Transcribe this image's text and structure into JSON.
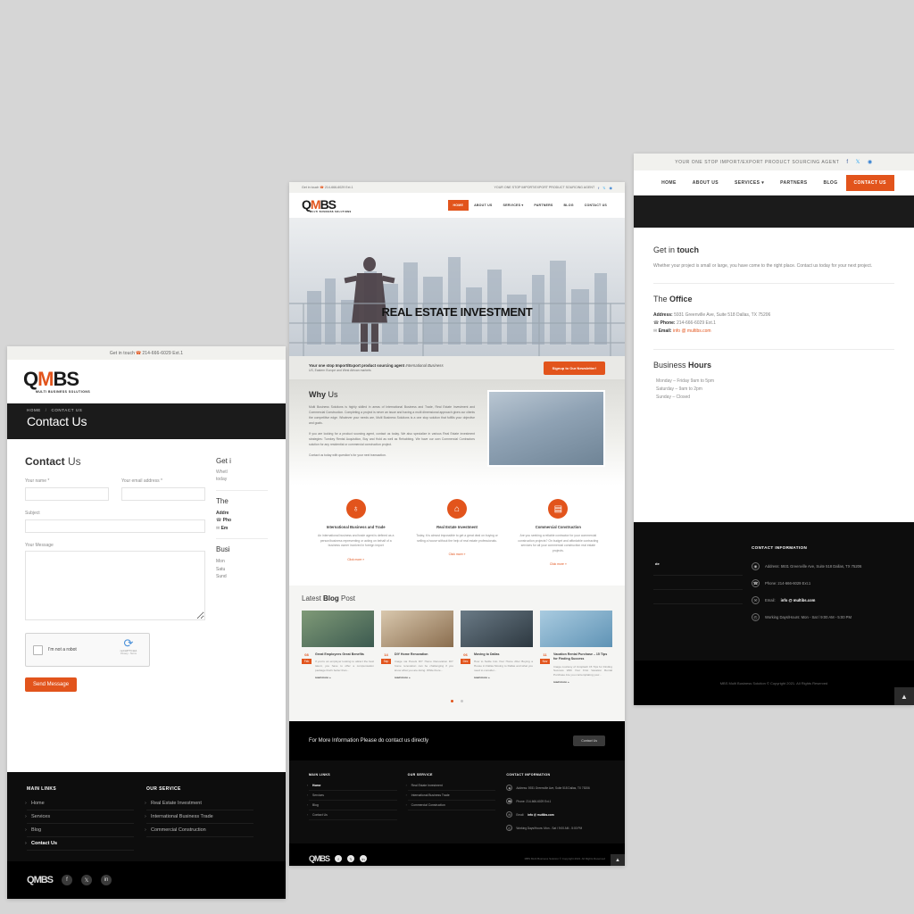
{
  "colors": {
    "accent": "#e2541c",
    "dark": "#0d0d0d",
    "page_bg": "#d6d6d6"
  },
  "brand": {
    "logo_q": "Q",
    "logo_m": "M",
    "logo_b": "BS",
    "logo_sub": "MULTI BUSINESS SOLUTIONS"
  },
  "window_contact_left": {
    "topbar": {
      "label": "Get in touch",
      "phone_icon": "phone-icon",
      "phone": "214-666-6029 Ext.1"
    },
    "breadcrumb": {
      "home": "HOME",
      "sep": "/",
      "current": "CONTACT US"
    },
    "page_title": "Contact Us",
    "form": {
      "heading_bold": "Contact",
      "heading_light": "Us",
      "name_label": "Your name *",
      "email_label": "Your email address *",
      "subject_label": "Subject",
      "message_label": "Your Message",
      "name_value": "",
      "email_value": "",
      "subject_value": "",
      "message_value": "",
      "captcha_text": "I'm not a robot",
      "captcha_brand": "reCAPTCHA",
      "captcha_privacy": "Privacy - Terms",
      "submit_label": "Send Message"
    },
    "side": {
      "get_in_touch_a": "Get i",
      "get_in_touch_b": "Whetl",
      "get_in_touch_c": "today",
      "office_head": "The ",
      "address_label": "Addre",
      "phone_label": "Pho",
      "email_label": "Em",
      "hours_head": "Busi",
      "hour1": "Mon",
      "hour2": "Satu",
      "hour3": "Sund"
    },
    "footer": {
      "main_links_head": "MAIN LINKS",
      "main_links": [
        "Home",
        "Services",
        "Blog",
        "Contact Us"
      ],
      "our_service_head": "OUR SERVICE",
      "our_service": [
        "Real Estate Investment",
        "International Business Trade",
        "Commercial Construction"
      ],
      "social": [
        "facebook-icon",
        "x-icon",
        "linkedin-icon"
      ]
    }
  },
  "window_home_middle": {
    "topbar": {
      "left_label": "Get in touch",
      "left_phone": "214-666-6029 Ext.1",
      "tagline": "YOUR ONE STOP IMPORT/EXPORT PRODUCT SOURCING AGENT",
      "social": [
        "facebook-icon",
        "x-icon",
        "instagram-icon"
      ]
    },
    "menu": [
      "HOME",
      "ABOUT US",
      "SERVICES",
      "PARTNERS",
      "BLOG",
      "CONTACT US"
    ],
    "menu_active": "HOME",
    "services_caret": "⌄",
    "hero": {
      "title": "REAL ESTATE INVESTMENT"
    },
    "strip": {
      "line1_bold": "Your one stop Import/Export  product sourcing agent ",
      "line1_italic": "International Business",
      "line2": "US, Eastern Europe and West African markets",
      "button": "Signup to Our Newsletter!"
    },
    "why": {
      "head_bold": "Why",
      "head_light": "Us",
      "p1": "Multi Business Solutions is highly skilled in areas of International Business and Trade, Real Estate Investment and Commercial Construction. Completing a project is never an issue and having a multi dimensional approach gives our clients the competitive edge. Whatever your needs are, Multi Business Solutions is a one stop solution that fulfills your objective and goals.",
      "p2": "If you are looking for a product sourcing agent, contact us today.  We also specialize in various Real Estate investment strategies: Turnkey Rental Acquisition, Buy and Hold as well as Rehabbing.  We have our own Commercial Contractors solution for any residential or commercial construction project.",
      "p3": "Contact us today with question's for your next transaction."
    },
    "services": [
      {
        "icon": "globe-icon",
        "icon_glyph": "♁",
        "title": "International Business and Trade",
        "text": "An international business and trade agent is defined as a person/business representing or acting on behalf of a business owner involved in foreign import",
        "link": "Click more »"
      },
      {
        "icon": "home-icon",
        "icon_glyph": "⌂",
        "title": "Real Estate Investment",
        "text": "Today, it is almost impossible to get a great deal on buying or selling a house without the help of real estate professionals.",
        "link": "Click more »"
      },
      {
        "icon": "building-icon",
        "icon_glyph": "▤",
        "title": "Commercial Construction",
        "text": "Are you seeking a reliable contractor for your commercial construction projects? On budget and affordable contracting services for all your commercial construction real estate projects.",
        "link": "Click more »"
      }
    ],
    "blog": {
      "head_light1": "Latest ",
      "head_bold": "Blog",
      "head_light2": " Post",
      "posts": [
        {
          "day": "08",
          "month": "Feb",
          "title": "Great Employees Great Benefits",
          "excerpt": "If you're an employer looking to attract the best talent, you have to offer a compensation package that's better than...",
          "more": "read more »"
        },
        {
          "day": "14",
          "month": "Sep",
          "title": "DIY Home Renovation",
          "excerpt": "Image via Pexels DIY Home Renovation DIY home renovation can be challenging if you know what you are doing. While there...",
          "more": "read more »"
        },
        {
          "day": "06",
          "month": "Dec",
          "title": "Moving to Dallas",
          "excerpt": "How to Settle Into Your Home After Buying a House in Dallas Moving to Dallas and what you need to consider...",
          "more": "read more »"
        },
        {
          "day": "11",
          "month": "Nov",
          "title": "Vacation Rental Purchase – 15 Tips for Finding Success",
          "excerpt": "Image courtesy of Unsplash 15 Tips for Finding Success With Your First Vacation Rental Purchase Are you contemplating your...",
          "more": "read more »"
        }
      ]
    },
    "cta": {
      "text": "For More Information Please do contact us directly",
      "button": "Contact Us"
    },
    "footer": {
      "main_links_head": "MAIN LINKS",
      "main_links": [
        "Home",
        "Services",
        "Blog",
        "Contact Us"
      ],
      "our_service_head": "OUR SERVICE",
      "our_service": [
        "Real Estate Investment",
        "International Business Trade",
        "Commercial Construction"
      ],
      "contact_head": "CONTACT INFORMATION",
      "contact": [
        {
          "icon": "location-icon",
          "glyph": "◉",
          "text": "Address: 5931 Greenville Ave, Suite 518 Dallas, TX 75206"
        },
        {
          "icon": "phone-icon",
          "glyph": "☎",
          "text": "Phone: 214-666-6029 Ext.1"
        },
        {
          "icon": "email-icon",
          "glyph": "✉",
          "text": "Email: ",
          "strong": "info @ multibs.com"
        },
        {
          "icon": "clock-icon",
          "glyph": "◴",
          "text": "Working Days/Hours: Mon - Sat / 9:00 AM - 5:00 PM"
        }
      ],
      "social": [
        "facebook-icon",
        "x-icon",
        "linkedin-icon"
      ],
      "copyright": "MBS Multi Business Solution © Copyright 2021. All Rights Reserved",
      "scroll_top": "scroll-top-icon"
    }
  },
  "window_contact_right": {
    "topbar": {
      "tagline": "YOUR ONE STOP IMPORT/EXPORT PRODUCT SOURCING AGENT",
      "social": [
        "facebook-icon",
        "x-icon",
        "instagram-icon"
      ]
    },
    "menu": [
      "HOME",
      "ABOUT US",
      "SERVICES",
      "PARTNERS",
      "BLOG",
      "CONTACT US"
    ],
    "menu_active": "CONTACT US",
    "services_caret": "⌄",
    "get_in_touch": {
      "head_light": "Get in ",
      "head_bold": "touch",
      "text": "Whether your project is small or large, you have come to the right place.  Contact us today for your next project."
    },
    "office": {
      "head_light": "The ",
      "head_bold": "Office",
      "address_label": "Address:",
      "address": " 5931 Greenville Ave, Suite 518 Dallas, TX 75206",
      "phone_icon": "phone-icon",
      "phone_label": "Phone:",
      "phone": " 214-666-6029 Ext.1",
      "email_icon": "email-icon",
      "email_label": "Email:",
      "email": "info @ multibs.com"
    },
    "hours": {
      "head_light": "Business ",
      "head_bold": "Hours",
      "rows": [
        "Monday – Friday 9am to 5pm",
        "Saturday – 9am to 2pm",
        "Sunday – Closed"
      ]
    },
    "footer": {
      "hl_item": "de",
      "contact_head": "CONTACT INFORMATION",
      "contact": [
        {
          "icon": "location-icon",
          "glyph": "◉",
          "text": "Address: 5931 Greenville Ave, Suite 518 Dallas, TX 75206"
        },
        {
          "icon": "phone-icon",
          "glyph": "☎",
          "text": "Phone: 214-666-6029 Ext.1"
        },
        {
          "icon": "email-icon",
          "glyph": "✉",
          "text": "Email: ",
          "strong": "info @ multibs.com"
        },
        {
          "icon": "clock-icon",
          "glyph": "◴",
          "text": "Working Days/Hours: Mon - Sat / 9:00 AM - 5:00 PM"
        }
      ],
      "copyright": "MBS Multi Business Solution © Copyright 2021. All Rights Reserved",
      "scroll_top": "scroll-top-icon"
    }
  }
}
